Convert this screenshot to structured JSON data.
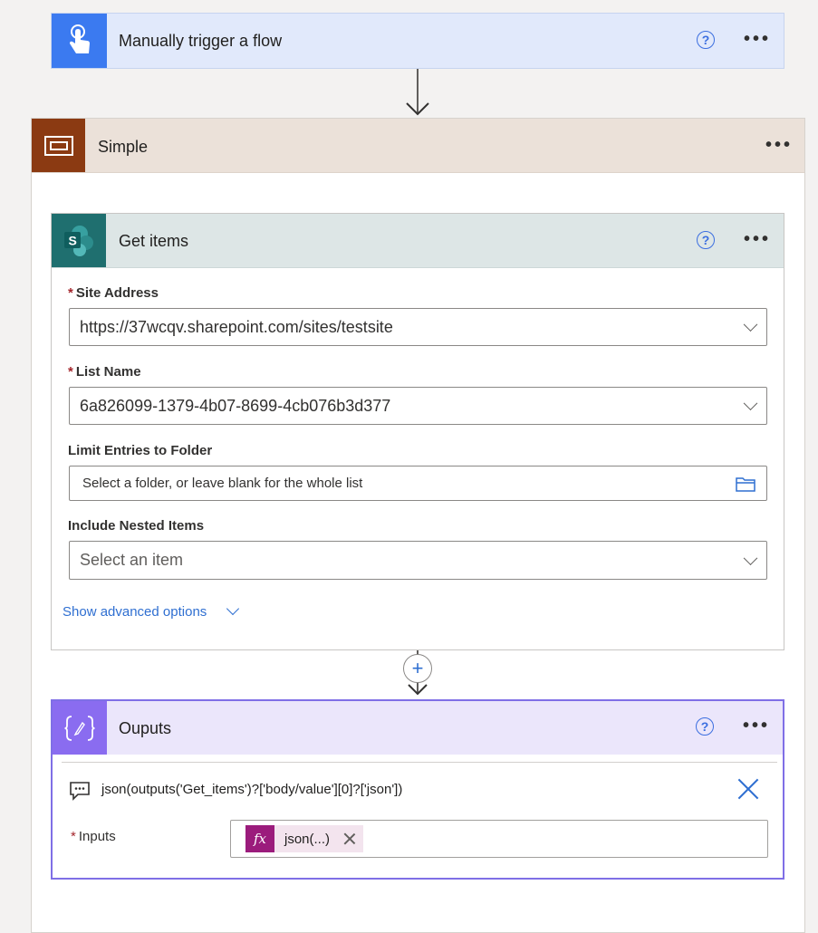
{
  "trigger": {
    "title": "Manually trigger a flow",
    "help": "?"
  },
  "scope": {
    "title": "Simple"
  },
  "get_items": {
    "title": "Get items",
    "help": "?",
    "site_address": {
      "label": "Site Address",
      "value": "https://37wcqv.sharepoint.com/sites/testsite"
    },
    "list_name": {
      "label": "List Name",
      "value": "6a826099-1379-4b07-8699-4cb076b3d377"
    },
    "limit_folder": {
      "label": "Limit Entries to Folder",
      "placeholder": "Select a folder, or leave blank for the whole list"
    },
    "nested_items": {
      "label": "Include Nested Items",
      "placeholder": "Select an item"
    },
    "advanced_link": "Show advanced options"
  },
  "outputs": {
    "title": "Ouputs",
    "help": "?",
    "expression": "json(outputs('Get_items')?['body/value'][0]?['json'])",
    "inputs_label": "Inputs",
    "token": {
      "fx": "fx",
      "label": "json(...)"
    }
  },
  "colors": {
    "trigger_icon": "#3b7af0",
    "scope_icon": "#8b3a12",
    "sharepoint_icon": "#1f6f6f",
    "compose_icon": "#8a6cf0",
    "accent": "#2f6fd1",
    "token_fx": "#9b1c7c"
  },
  "icons": {
    "trigger": "touch-hand-icon",
    "scope": "scope-frame-icon",
    "get_items": "sharepoint-logo-icon",
    "outputs": "compose-braces-icon"
  }
}
